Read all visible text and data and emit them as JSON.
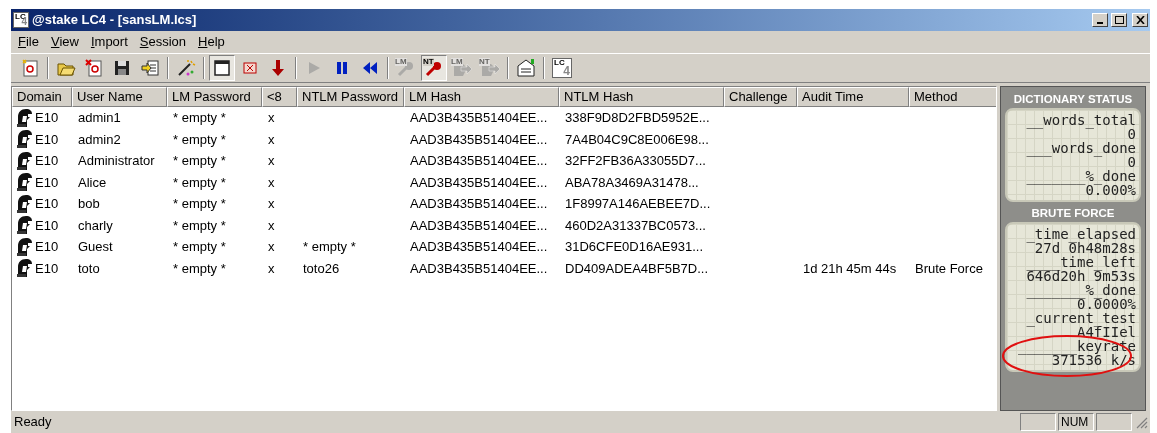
{
  "window": {
    "title": "@stake LC4 - [sansLM.lcs]",
    "icon_text": [
      "LC",
      "4"
    ]
  },
  "menu": [
    {
      "label": "File"
    },
    {
      "label": "View"
    },
    {
      "label": "Import"
    },
    {
      "label": "Session"
    },
    {
      "label": "Help"
    }
  ],
  "toolbar": [
    {
      "kind": "new",
      "pressed": false,
      "disabled": false
    },
    {
      "kind": "sep"
    },
    {
      "kind": "open",
      "pressed": false,
      "disabled": false
    },
    {
      "kind": "delete",
      "pressed": false,
      "disabled": false
    },
    {
      "kind": "save",
      "pressed": false,
      "disabled": false
    },
    {
      "kind": "import",
      "pressed": false,
      "disabled": false
    },
    {
      "kind": "sep"
    },
    {
      "kind": "wizard",
      "pressed": false,
      "disabled": false
    },
    {
      "kind": "sep"
    },
    {
      "kind": "window",
      "pressed": true,
      "disabled": false
    },
    {
      "kind": "stopbox",
      "pressed": false,
      "disabled": false
    },
    {
      "kind": "down",
      "pressed": false,
      "disabled": false
    },
    {
      "kind": "sep"
    },
    {
      "kind": "play",
      "pressed": false,
      "disabled": true
    },
    {
      "kind": "pause",
      "pressed": false,
      "disabled": false
    },
    {
      "kind": "rewind",
      "pressed": false,
      "disabled": false
    },
    {
      "kind": "sep"
    },
    {
      "kind": "key",
      "label": "LM",
      "pressed": false,
      "disabled": true
    },
    {
      "kind": "key",
      "label": "NT",
      "pressed": true,
      "disabled": false
    },
    {
      "kind": "export",
      "label": "LM",
      "pressed": false,
      "disabled": true
    },
    {
      "kind": "export",
      "label": "NT",
      "pressed": false,
      "disabled": true
    },
    {
      "kind": "sep"
    },
    {
      "kind": "report",
      "pressed": false,
      "disabled": false
    },
    {
      "kind": "sep"
    },
    {
      "kind": "logo",
      "text": [
        "LC",
        "4"
      ],
      "pressed": false,
      "disabled": false
    }
  ],
  "table": {
    "columns": [
      "Domain",
      "User Name",
      "LM Password",
      "<8",
      "NTLM Password",
      "LM Hash",
      "NTLM Hash",
      "Challenge",
      "Audit Time",
      "Method"
    ],
    "rows": [
      [
        "E10",
        "admin1",
        "* empty *",
        "x",
        "",
        "AAD3B435B51404EE...",
        "338F9D8D2FBD5952E...",
        "",
        "",
        ""
      ],
      [
        "E10",
        "admin2",
        "* empty *",
        "x",
        "",
        "AAD3B435B51404EE...",
        "7A4B04C9C8E006E98...",
        "",
        "",
        ""
      ],
      [
        "E10",
        "Administrator",
        "* empty *",
        "x",
        "",
        "AAD3B435B51404EE...",
        "32FF2FB36A33055D7...",
        "",
        "",
        ""
      ],
      [
        "E10",
        "Alice",
        "* empty *",
        "x",
        "",
        "AAD3B435B51404EE...",
        "ABA78A3469A31478...",
        "",
        "",
        ""
      ],
      [
        "E10",
        "bob",
        "* empty *",
        "x",
        "",
        "AAD3B435B51404EE...",
        "1F8997A146AEBEE7D...",
        "",
        "",
        ""
      ],
      [
        "E10",
        "charly",
        "* empty *",
        "x",
        "",
        "AAD3B435B51404EE...",
        "460D2A31337BC0573...",
        "",
        "",
        ""
      ],
      [
        "E10",
        "Guest",
        "* empty *",
        "x",
        "* empty *",
        "AAD3B435B51404EE...",
        "31D6CFE0D16AE931...",
        "",
        "",
        ""
      ],
      [
        "E10",
        "toto",
        "* empty *",
        "x",
        "toto26",
        "AAD3B435B51404EE...",
        "DD409ADEA4BF5B7D...",
        "",
        "1d 21h 45m 44s",
        "Brute Force"
      ]
    ]
  },
  "panels": [
    {
      "title": "DICTIONARY STATUS",
      "lines": [
        {
          "label": "__words_total",
          "value": "0"
        },
        {
          "label": "___words_done",
          "value": "0"
        },
        {
          "label": "_______%_done",
          "value": "0.000%"
        }
      ]
    },
    {
      "title": "BRUTE FORCE",
      "lines": [
        {
          "label": "_time_elapsed",
          "value": "27d 0h48m28s"
        },
        {
          "label": "____time_left",
          "value": "646d20h 9m53s"
        },
        {
          "label": "_______%_done",
          "value": "0.0000%"
        },
        {
          "label": "_current_test",
          "value": "A4fIIel"
        },
        {
          "label": "_______keyrate",
          "value": "371536 k/s"
        }
      ]
    }
  ],
  "status_bar": {
    "text": "Ready",
    "indicators": [
      {
        "kind": "blank"
      },
      {
        "kind": "text",
        "text": "NUM"
      },
      {
        "kind": "blank"
      }
    ]
  }
}
